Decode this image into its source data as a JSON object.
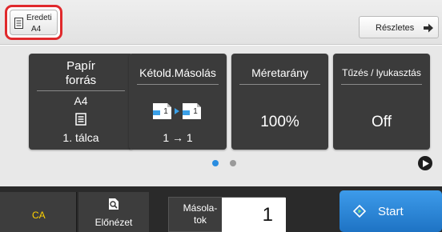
{
  "topbar": {
    "original_label": "Eredeti",
    "original_value": "A4",
    "details_label": "Részletes",
    "highlight_color": "#e0292c"
  },
  "tiles": {
    "paper": {
      "title": "Papír forrás",
      "size": "A4",
      "tray": "1. tálca",
      "icon": "paper-tray-icon"
    },
    "duplex": {
      "title": "Kétold.Másolás",
      "mode": "1 → 1",
      "icon_page_1": "1",
      "icon_page_2": "1",
      "icon": "duplex-copy-icon"
    },
    "ratio": {
      "title": "Méretarány",
      "value": "100%"
    },
    "staple": {
      "title": "Tűzés / lyukasztás",
      "value": "Off"
    }
  },
  "pager": {
    "active_color": "#2a8de0",
    "inactive_color": "#9a9a9a",
    "next_icon": "play-arrow-icon"
  },
  "bottombar": {
    "ca_label": "CA",
    "preview_label": "Előnézet",
    "copies_label_line1": "Másola-",
    "copies_label_line2": "tok",
    "copies_value": "1",
    "start_label": "Start",
    "ca_color": "#ffd200",
    "start_color": "#2a85d8"
  }
}
